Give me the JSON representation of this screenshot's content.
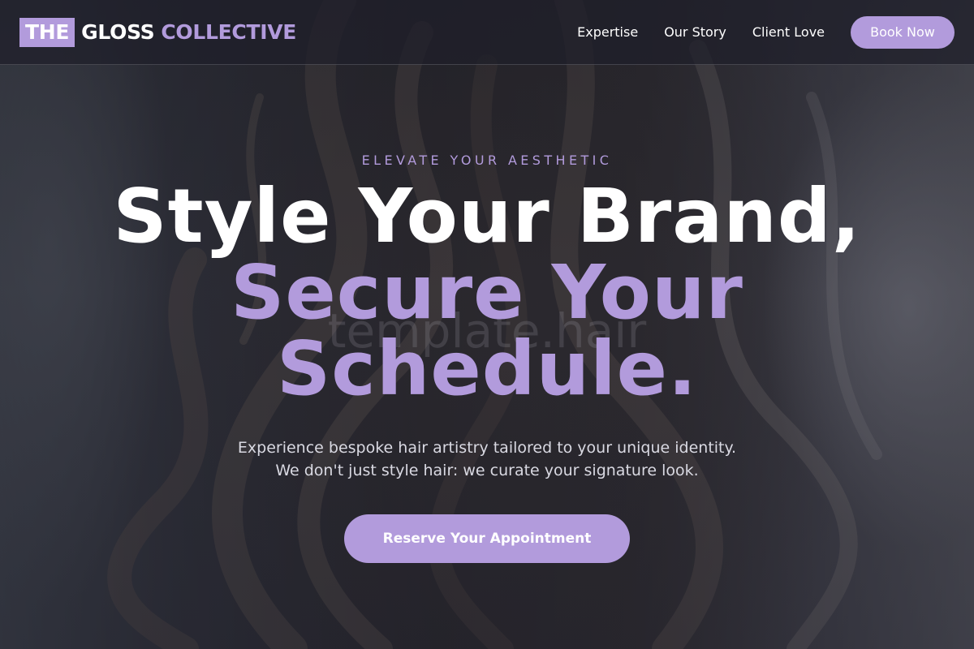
{
  "brand": {
    "logo_the": "THE",
    "logo_gloss": "GLOSS",
    "logo_collective": "COLLECTIVE",
    "accent_color": "#b29bdc"
  },
  "nav": {
    "items": [
      {
        "label": "Expertise"
      },
      {
        "label": "Our Story"
      },
      {
        "label": "Client Love"
      }
    ],
    "book_label": "Book Now"
  },
  "hero": {
    "eyebrow": "ELEVATE YOUR AESTHETIC",
    "headline_line1": "Style Your Brand,",
    "headline_line2": "Secure Your",
    "headline_line3": "Schedule.",
    "watermark": "template.hair",
    "subcopy_line1": "Experience bespoke hair artistry tailored to your unique identity.",
    "subcopy_line2": "We don't just style hair: we curate your signature look.",
    "cta_label": "Reserve Your Appointment"
  }
}
